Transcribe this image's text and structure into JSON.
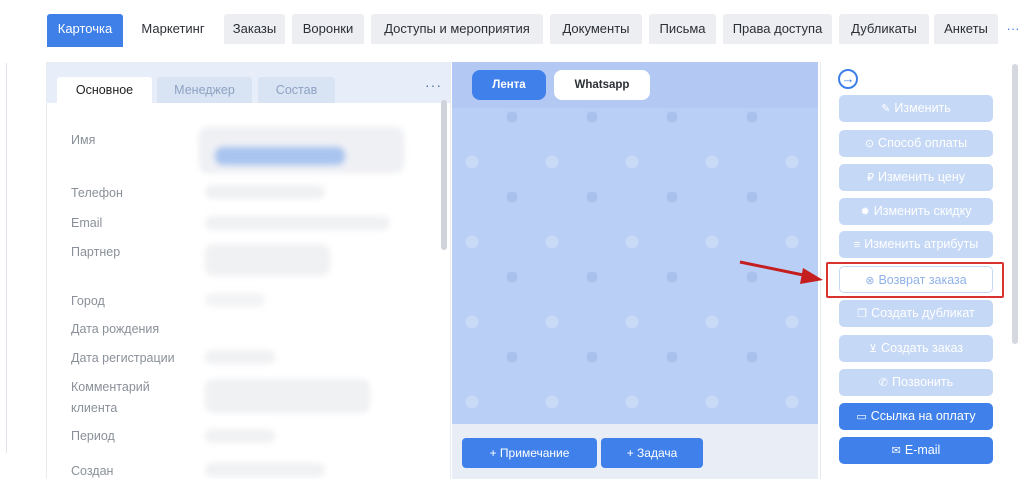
{
  "top_tabs": [
    "Карточка",
    "Маркетинг",
    "Заказы",
    "Воронки",
    "Доступы и мероприятия",
    "Документы",
    "Письма",
    "Права доступа",
    "Дубликаты",
    "Анкеты",
    "···"
  ],
  "left_panel": {
    "tabs": [
      "Основное",
      "Менеджер",
      "Состав"
    ],
    "more": "···",
    "fields": [
      "Имя",
      "Телефон",
      "Email",
      "Партнер",
      "Город",
      "Дата рождения",
      "Дата регистрации",
      "Комментарий",
      "клиента",
      "Период",
      "Создан"
    ]
  },
  "chat": {
    "tabs": [
      "Лента",
      "Whatsapp"
    ],
    "buttons": [
      "+ Примечание",
      "+ Задача"
    ]
  },
  "actions": {
    "items": [
      {
        "icon": "user-edit-icon",
        "glyph": "✎",
        "label": "Изменить"
      },
      {
        "icon": "payment-method-icon",
        "glyph": "⊙",
        "label": "Способ оплаты"
      },
      {
        "icon": "ruble-icon",
        "glyph": "₽",
        "label": "Изменить цену"
      },
      {
        "icon": "discount-icon",
        "glyph": "✹",
        "label": "Изменить скидку"
      },
      {
        "icon": "attributes-icon",
        "glyph": "≡",
        "label": "Изменить атрибуты"
      },
      {
        "icon": "return-icon",
        "glyph": "⊗",
        "label": "Возврат заказа"
      },
      {
        "icon": "duplicate-icon",
        "glyph": "❐",
        "label": "Создать дубликат"
      },
      {
        "icon": "cart-icon",
        "glyph": "⊻",
        "label": "Создать заказ"
      },
      {
        "icon": "phone-icon",
        "glyph": "✆",
        "label": "Позвонить"
      },
      {
        "icon": "card-icon",
        "glyph": "▭",
        "label": "Ссылка на оплату"
      },
      {
        "icon": "mail-icon",
        "glyph": "✉",
        "label": "E-mail"
      }
    ]
  },
  "colors": {
    "accent": "#3e7fe8",
    "highlight": "#d9332f",
    "arrow": "#c41e1e"
  }
}
